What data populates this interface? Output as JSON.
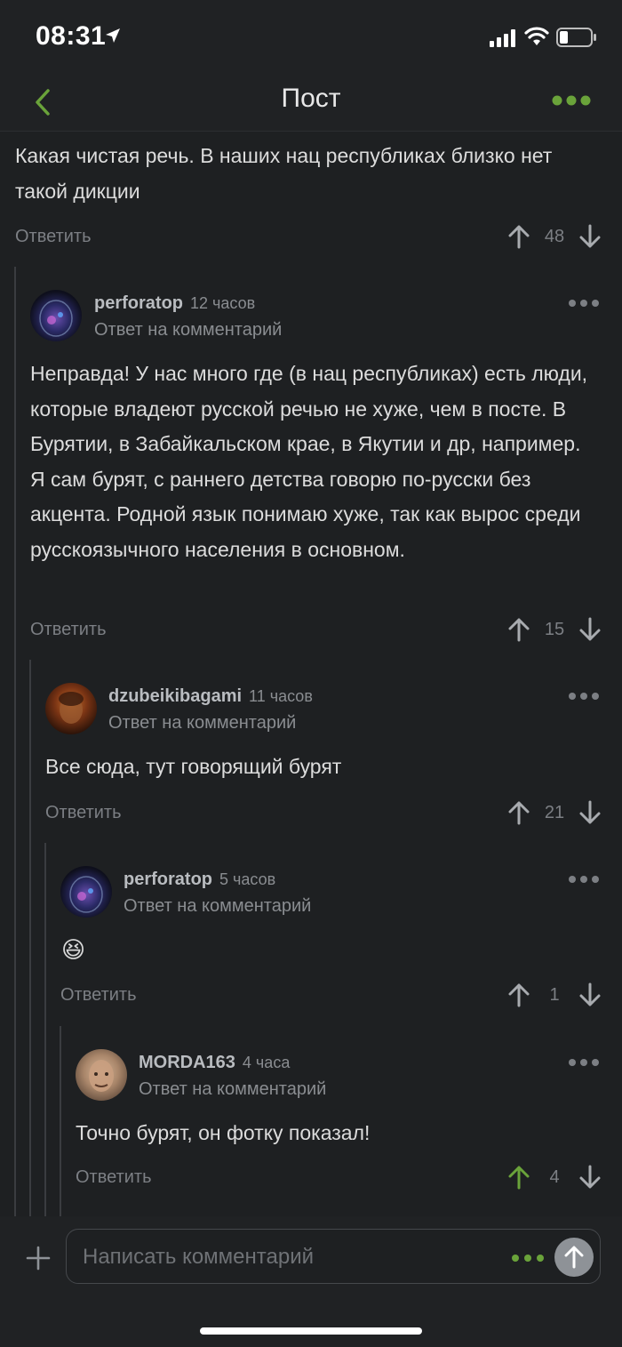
{
  "status": {
    "time": "08:31"
  },
  "nav": {
    "title": "Пост"
  },
  "comments": [
    {
      "text": "Какая чистая речь. В наших нац республиках близко нет такой дикции",
      "reply_label": "Ответить",
      "rating": "48"
    },
    {
      "username": "perforatop",
      "time": "12 часов",
      "subline": "Ответ на комментарий",
      "text": "Неправда! У нас много где (в нац республиках) есть люди, которые владеют русской речью не хуже, чем в посте. В Бурятии, в Забайкальском крае, в Якутии и др, например. Я сам бурят, с раннего детства говорю по-русски без акцента. Родной язык понимаю хуже, так как вырос среди русскоязычного населения в основном.",
      "reply_label": "Ответить",
      "rating": "15"
    },
    {
      "username": "dzubeikibagami",
      "time": "11 часов",
      "subline": "Ответ на комментарий",
      "text": "Все сюда, тут говорящий бурят",
      "reply_label": "Ответить",
      "rating": "21"
    },
    {
      "username": "perforatop",
      "time": "5 часов",
      "subline": "Ответ на комментарий",
      "text": "😆",
      "reply_label": "Ответить",
      "rating": "1"
    },
    {
      "username": "MORDA163",
      "time": "4 часа",
      "subline": "Ответ на комментарий",
      "text": "Точно бурят, он фотку показал!",
      "reply_label": "Ответить",
      "rating": "4",
      "upvoted": true
    }
  ],
  "composer": {
    "placeholder": "Написать комментарий"
  },
  "colors": {
    "accent": "#6aa33a",
    "background": "#1e2022",
    "muted": "#7c7f84"
  }
}
